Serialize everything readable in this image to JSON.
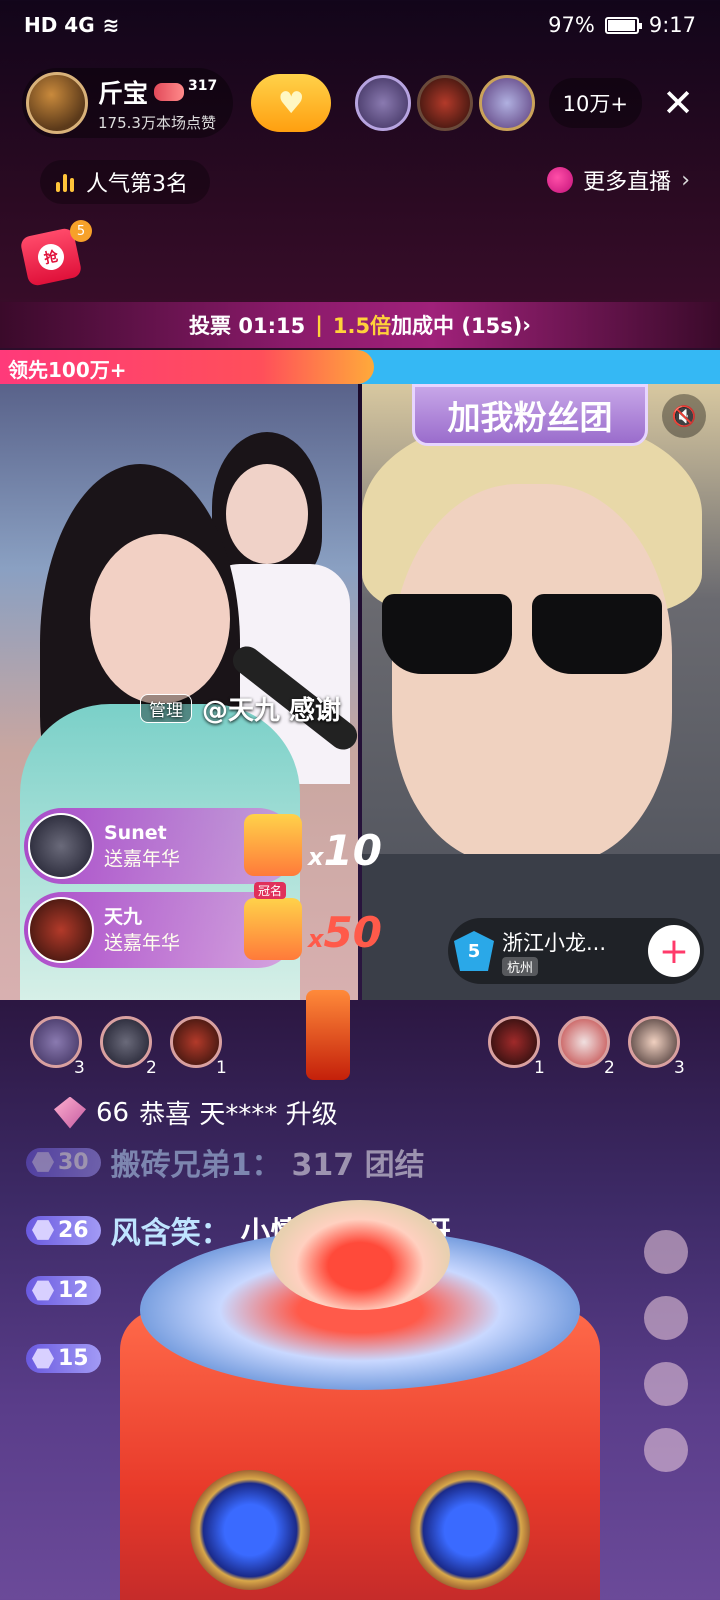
{
  "status_bar": {
    "left": "HD 4G",
    "battery": "97%",
    "battery_level": 0.97,
    "time": "9:17"
  },
  "host": {
    "name": "斤宝",
    "level": "317",
    "likes": "175.3万本场点赞"
  },
  "viewers": {
    "count": "10万+"
  },
  "rank": {
    "label": "人气第3名"
  },
  "more_live": {
    "label": "更多直播"
  },
  "red_packet": {
    "icon_char": "抢",
    "count": "5"
  },
  "vote": {
    "label": "投票 01:15",
    "multiplier": "1.5倍",
    "rest": "加成中 (15s)",
    "chevron": "›"
  },
  "pk": {
    "lead_label": "领先100万+",
    "red_share": 0.52
  },
  "right_pane": {
    "sign": "加我粉丝团",
    "guest_name": "浙江小龙...",
    "guest_city": "杭州",
    "guest_level": "5"
  },
  "admin_msg": {
    "tag": "管理",
    "text": "@天九 感谢"
  },
  "gifts": [
    {
      "user": "Sunet",
      "action": "送嘉年华",
      "combo": "10"
    },
    {
      "user": "天九",
      "action": "送嘉年华",
      "combo": "50",
      "crown": "冠名"
    }
  ],
  "fans_left": [
    "3",
    "2",
    "1"
  ],
  "fans_right": [
    "1",
    "2",
    "3"
  ],
  "upgrade": {
    "level": "66",
    "text": "恭喜 天**** 升级"
  },
  "chat": [
    {
      "level": "30",
      "user": "搬砖兄弟1：",
      "msg": "317 团结"
    },
    {
      "level": "26",
      "user": "风含笑：",
      "msg": "小情绪好厉害呀"
    },
    {
      "level": "12",
      "user": "",
      "msg": ""
    },
    {
      "level": "15",
      "user": "",
      "msg": ""
    }
  ],
  "colors": {
    "accent_gold": "#ffd23a",
    "pk_red": "#ff3a7a",
    "pk_blue": "#35b8f4"
  },
  "icons": [
    "wifi-icon",
    "battery-icon",
    "close-icon",
    "rank-bars-icon",
    "chevron-right-icon",
    "mute-icon",
    "plus-icon",
    "gem-icon"
  ]
}
